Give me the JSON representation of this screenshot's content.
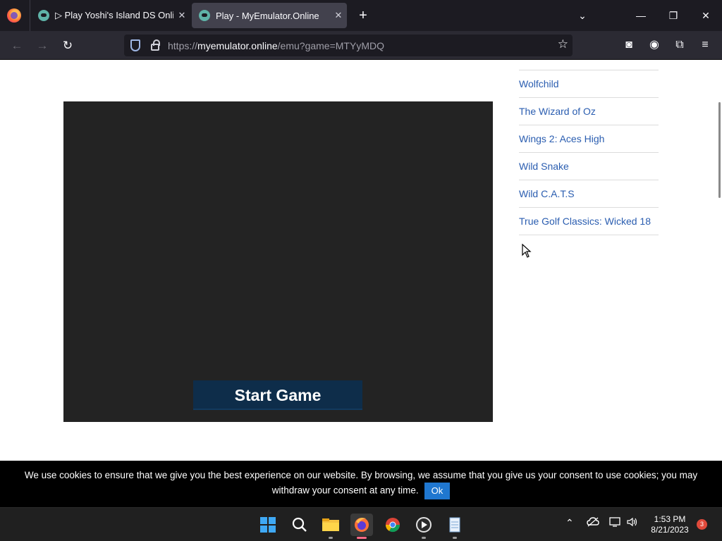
{
  "browser": {
    "tabs": [
      {
        "title": "▷ Play Yoshi's Island DS Online",
        "close": "✕"
      },
      {
        "title": "Play - MyEmulator.Online",
        "close": "✕"
      }
    ],
    "new_tab": "+",
    "tab_list": "⌄",
    "window": {
      "minimize": "—",
      "restore": "❐",
      "close": "✕"
    },
    "nav": {
      "back": "←",
      "forward": "→",
      "reload": "↻"
    },
    "url": {
      "prefix": "https://",
      "domain": "myemulator.online",
      "path": "/emu?game=MTYyMDQ"
    },
    "toolbar": {
      "star": "☆",
      "pocket": "◙",
      "account": "◉",
      "extensions": "⧉",
      "menu": "≡"
    }
  },
  "emulator": {
    "start_label": "Start Game"
  },
  "sidebar": {
    "games": [
      "Wolfchild",
      "The Wizard of Oz",
      "Wings 2: Aces High",
      "Wild Snake",
      "Wild C.A.T.S",
      "True Golf Classics: Wicked 18"
    ]
  },
  "cookie": {
    "text": "We use cookies to ensure that we give you the best experience on our website. By browsing, we assume that you give us your consent to use cookies; you may withdraw your consent at any time.",
    "ok": "Ok"
  },
  "taskbar": {
    "time": "1:53 PM",
    "date": "8/21/2023",
    "notifications": "3",
    "apps": [
      "start-icon",
      "search-icon",
      "file-explorer-icon",
      "firefox-icon",
      "chrome-icon",
      "media-player-icon",
      "notepad-icon"
    ]
  }
}
